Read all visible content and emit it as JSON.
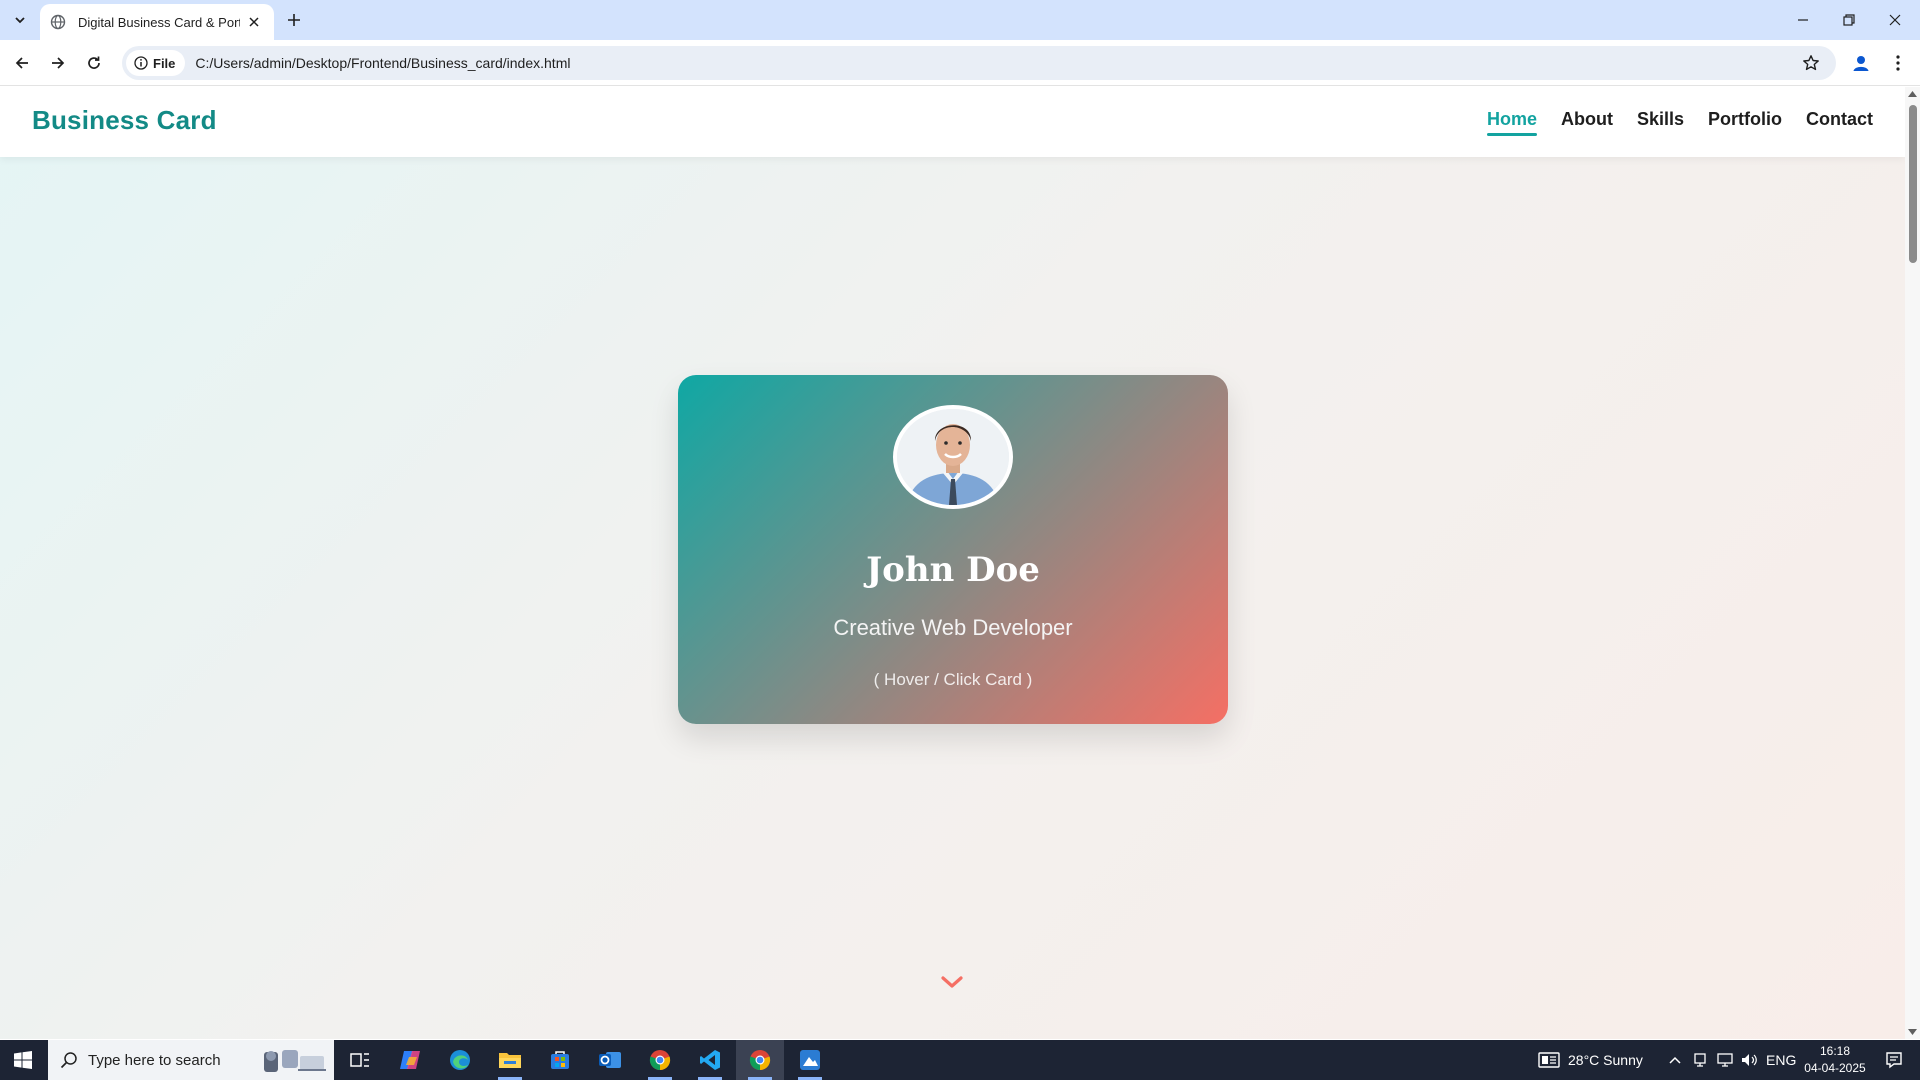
{
  "browser": {
    "tab_title": "Digital Business Card & Portfolio",
    "site_chip_label": "File",
    "url": "C:/Users/admin/Desktop/Frontend/Business_card/index.html"
  },
  "site": {
    "brand": "Business Card",
    "nav": [
      "Home",
      "About",
      "Skills",
      "Portfolio",
      "Contact"
    ],
    "active_nav": "Home",
    "card": {
      "name": "John Doe",
      "role": "Creative Web Developer",
      "hint": "( Hover / Click Card )"
    }
  },
  "colors": {
    "brand": "#138a86",
    "accent": "#13a3a0",
    "card_gradient_start": "#0fa8a4",
    "card_gradient_end": "#f56f64",
    "chevron": "#f56f64"
  },
  "taskbar": {
    "search_placeholder": "Type here to search",
    "weather": "28°C  Sunny",
    "language": "ENG",
    "time": "16:18",
    "date": "04-04-2025",
    "apps": [
      "task-view",
      "copilot",
      "edge",
      "file-explorer",
      "microsoft-store",
      "outlook",
      "chrome",
      "vs-code",
      "chrome",
      "image-app"
    ]
  }
}
